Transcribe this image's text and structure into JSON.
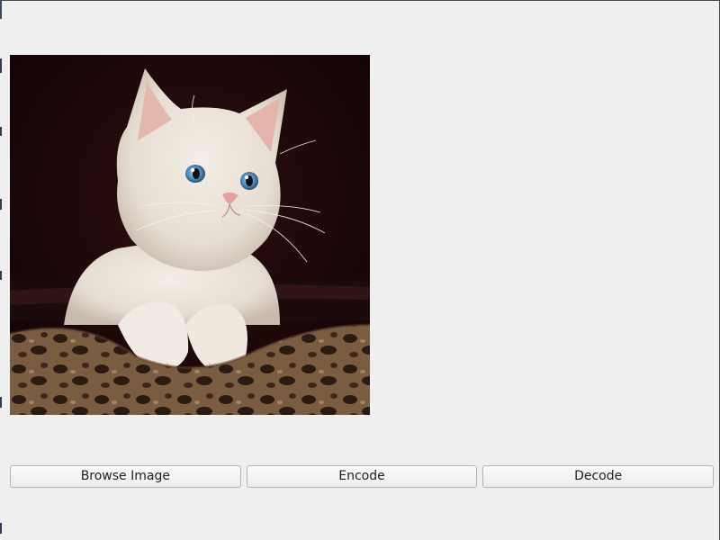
{
  "image": {
    "subject": "kitten-photo"
  },
  "buttons": {
    "browse_label": "Browse Image",
    "encode_label": "Encode",
    "decode_label": "Decode"
  },
  "colors": {
    "window_bg": "#efefef",
    "button_border": "#b4b4b4"
  }
}
